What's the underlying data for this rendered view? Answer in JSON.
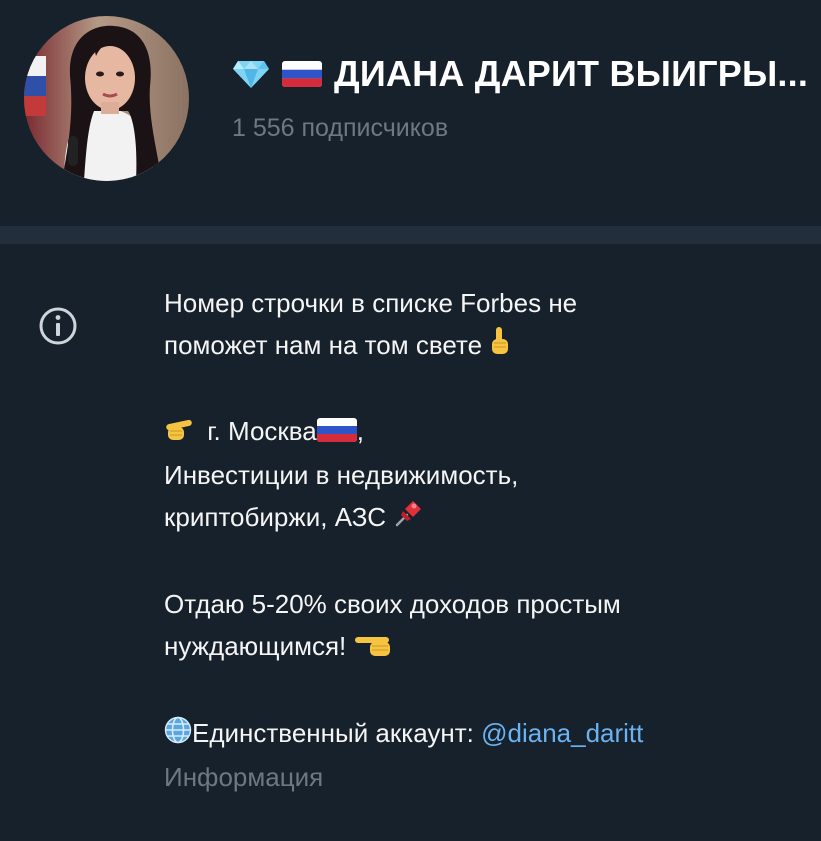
{
  "channel": {
    "title": "ДИАНА ДАРИТ ВЫИГРЫ...",
    "title_emoji": [
      "diamond-icon",
      "russia-flag-icon"
    ],
    "subscribers": "1 556 подписчиков"
  },
  "info": {
    "line1": "Номер строчки в списке Forbes не",
    "line2": "поможет нам на том свете",
    "line3": "г. Москва",
    "line3_suffix": ",",
    "line4": "Инвестиции в недвижимость,",
    "line5": "криптобиржи, АЗС",
    "line6": "Отдаю 5-20% своих доходов простым",
    "line7": "нуждающимся!",
    "line8_prefix": "Единственный аккаунт: ",
    "account_link": "@diana_daritt",
    "caption": "Информация"
  },
  "colors": {
    "background": "#17212b",
    "divider": "#232e3c",
    "link": "#6ab2f2",
    "muted": "#6d7883"
  }
}
